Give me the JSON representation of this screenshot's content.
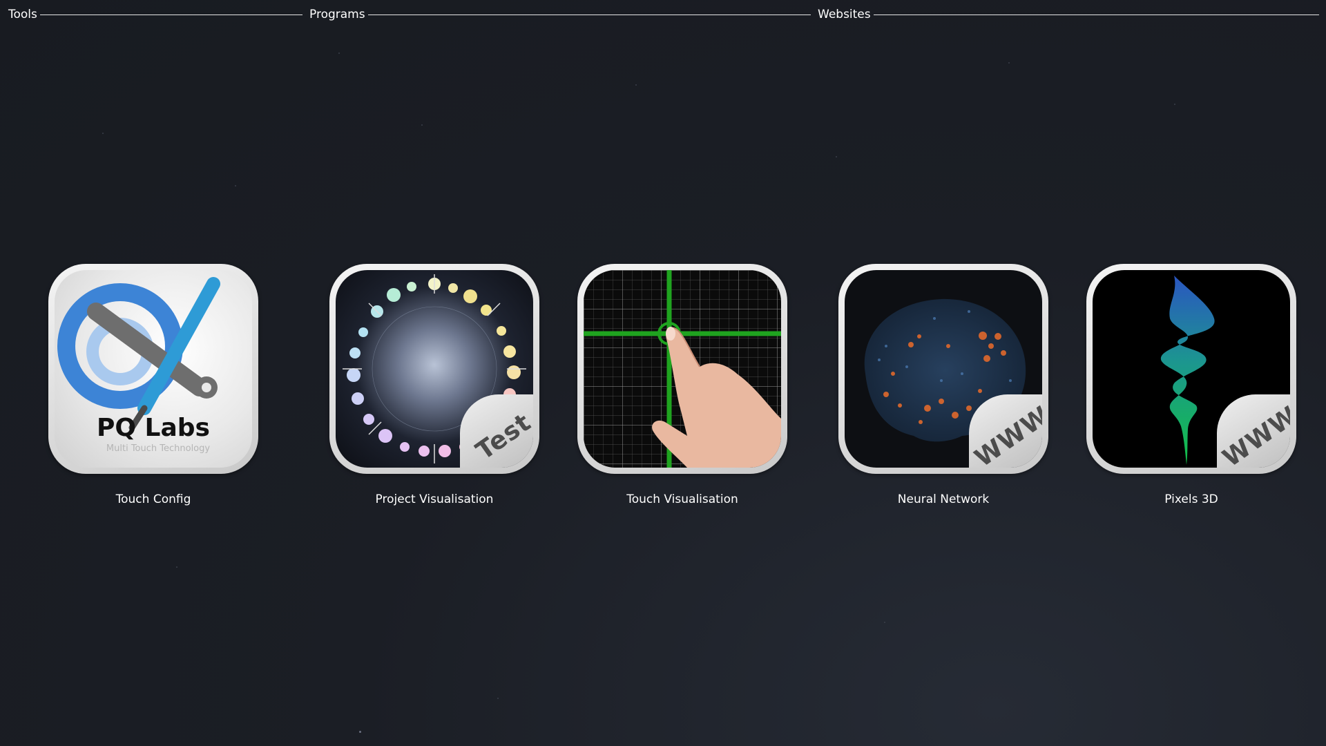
{
  "sections": {
    "tools": "Tools",
    "programs": "Programs",
    "websites": "Websites"
  },
  "tiles": [
    {
      "label": "Touch Config",
      "icon": "pq-labs-tools-icon",
      "logo_text": "PQ Labs",
      "logo_sub": "Multi Touch Technology"
    },
    {
      "label": "Project Visualisation",
      "icon": "project-visualisation-icon",
      "badge": "Test"
    },
    {
      "label": "Touch Visualisation",
      "icon": "touch-grid-finger-icon"
    },
    {
      "label": "Neural Network",
      "icon": "neural-network-icon",
      "badge": "WWW"
    },
    {
      "label": "Pixels 3D",
      "icon": "pixels-3d-icon",
      "badge": "WWW"
    }
  ],
  "colors": {
    "background": "#1b1e25",
    "tile_frame": "#e0e0e0",
    "grid_green": "#1fa31f",
    "pq_blue": "#3d84d6"
  }
}
